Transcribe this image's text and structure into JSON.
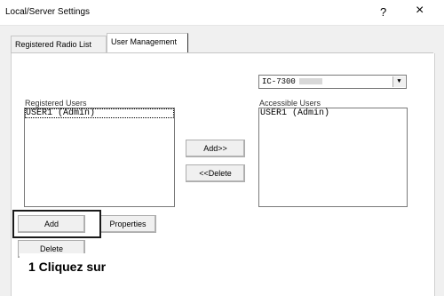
{
  "window": {
    "title": "Local/Server Settings",
    "help_label": "?",
    "close_label": "×"
  },
  "tabs": [
    {
      "label": "Registered Radio List"
    },
    {
      "label": "User Management"
    }
  ],
  "radio_select": {
    "value": "IC-7300"
  },
  "registered_users": {
    "label": "Registered Users",
    "items": [
      "USER1 (Admin)"
    ]
  },
  "accessible_users": {
    "label": "Accessible Users",
    "items": [
      "USER1 (Admin)"
    ]
  },
  "buttons": {
    "add_to_accessible": "Add>>",
    "delete_from_accessible": "<<Delete",
    "add": "Add",
    "properties": "Properties",
    "delete": "Delete"
  },
  "callout": {
    "text": "1 Cliquez sur"
  }
}
